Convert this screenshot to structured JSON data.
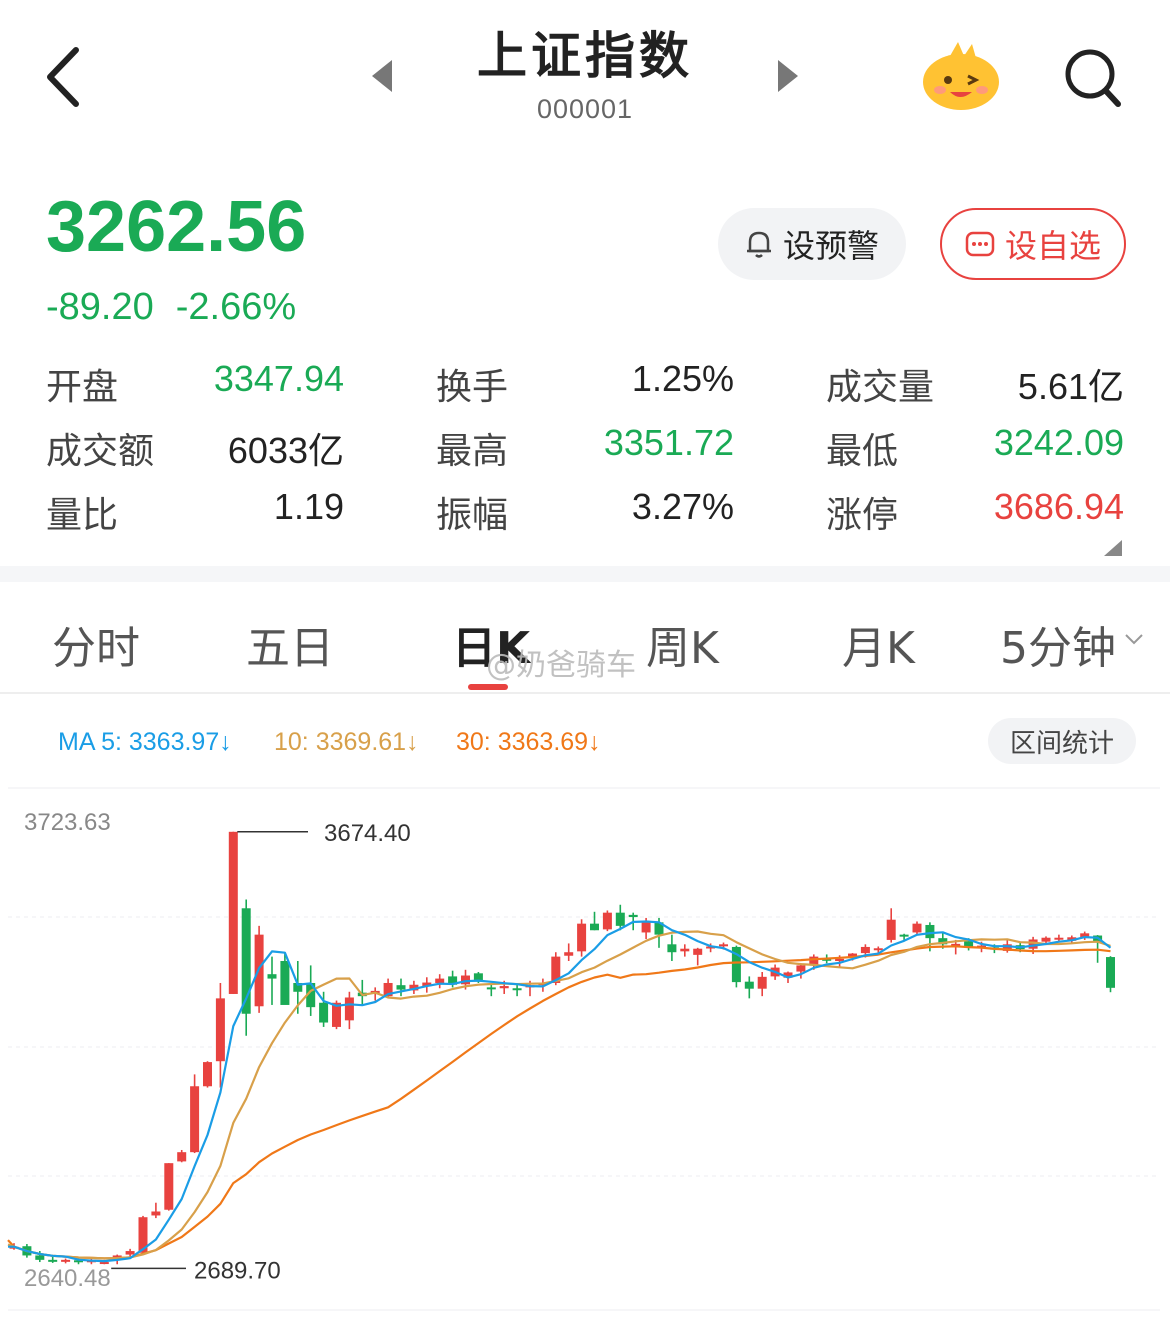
{
  "header": {
    "title": "上证指数",
    "code": "000001"
  },
  "quote": {
    "price": "3262.56",
    "change": "-89.20",
    "change_pct": "-2.66%",
    "color_down": "#1aaa55",
    "color_up": "#e8423f"
  },
  "buttons": {
    "alert": "设预警",
    "favorite": "设自选"
  },
  "stats": [
    {
      "label": "开盘",
      "value": "3347.94",
      "tone": "green"
    },
    {
      "label": "换手",
      "value": "1.25%",
      "tone": "dark"
    },
    {
      "label": "成交量",
      "value": "5.61亿",
      "tone": "dark"
    },
    {
      "label": "成交额",
      "value": "6033亿",
      "tone": "dark"
    },
    {
      "label": "最高",
      "value": "3351.72",
      "tone": "green"
    },
    {
      "label": "最低",
      "value": "3242.09",
      "tone": "green"
    },
    {
      "label": "量比",
      "value": "1.19",
      "tone": "dark"
    },
    {
      "label": "振幅",
      "value": "3.27%",
      "tone": "dark"
    },
    {
      "label": "涨停",
      "value": "3686.94",
      "tone": "red"
    }
  ],
  "tabs": [
    {
      "label": "分时"
    },
    {
      "label": "五日"
    },
    {
      "label": "日K"
    },
    {
      "label": "周K"
    },
    {
      "label": "月K"
    },
    {
      "label": "5分钟"
    }
  ],
  "active_tab": "日K",
  "watermark": "@奶爸骑车",
  "ma": {
    "ma5": "MA 5: 3363.97",
    "ma10": "10: 3369.61",
    "ma30": "30: 3363.69",
    "arrow": "↓",
    "colors": {
      "ma5": "#1a9de6",
      "ma10": "#d8a04a",
      "ma30": "#f07818"
    }
  },
  "range_stats": "区间统计",
  "chart_data": {
    "type": "candlestick",
    "y_axis_labels": {
      "top": "3723.63",
      "bottom": "2640.48"
    },
    "ylim": [
      2640.48,
      3723.63
    ],
    "annotations": {
      "high": "3674.40",
      "low": "2689.70"
    },
    "candles": [
      [
        2728,
        2738,
        2723,
        2730
      ],
      [
        2731,
        2736,
        2705,
        2710
      ],
      [
        2710,
        2720,
        2695,
        2700
      ],
      [
        2700,
        2707,
        2693,
        2697
      ],
      [
        2697,
        2703,
        2692,
        2700
      ],
      [
        2699,
        2705,
        2690,
        2695
      ],
      [
        2696,
        2702,
        2690,
        2699
      ],
      [
        2695,
        2700,
        2690,
        2695
      ],
      [
        2700,
        2712,
        2690,
        2710
      ],
      [
        2712,
        2725,
        2705,
        2720
      ],
      [
        2716,
        2800,
        2714,
        2797
      ],
      [
        2801,
        2830,
        2795,
        2810
      ],
      [
        2814,
        2920,
        2812,
        2920
      ],
      [
        2924,
        2950,
        2922,
        2945
      ],
      [
        2945,
        3122,
        2943,
        3095
      ],
      [
        3095,
        3152,
        3092,
        3150
      ],
      [
        3152,
        3330,
        3092,
        3295
      ],
      [
        3305,
        3674,
        3305,
        3674
      ],
      [
        3500,
        3520,
        3210,
        3260
      ],
      [
        3277,
        3460,
        3262,
        3440
      ],
      [
        3350,
        3390,
        3280,
        3340
      ],
      [
        3380,
        3400,
        3380,
        3280
      ],
      [
        3330,
        3380,
        3260,
        3310
      ],
      [
        3330,
        3370,
        3255,
        3275
      ],
      [
        3285,
        3310,
        3230,
        3240
      ],
      [
        3230,
        3290,
        3225,
        3285
      ],
      [
        3245,
        3310,
        3225,
        3297
      ],
      [
        3308,
        3337,
        3280,
        3300
      ],
      [
        3305,
        3320,
        3290,
        3312
      ],
      [
        3300,
        3340,
        3295,
        3330
      ],
      [
        3325,
        3340,
        3300,
        3315
      ],
      [
        3313,
        3335,
        3305,
        3326
      ],
      [
        3322,
        3343,
        3308,
        3331
      ],
      [
        3330,
        3350,
        3318,
        3340
      ],
      [
        3345,
        3358,
        3320,
        3326
      ],
      [
        3327,
        3360,
        3315,
        3347
      ],
      [
        3352,
        3355,
        3330,
        3333
      ],
      [
        3320,
        3330,
        3300,
        3318
      ],
      [
        3318,
        3335,
        3305,
        3323
      ],
      [
        3318,
        3330,
        3300,
        3315
      ],
      [
        3320,
        3335,
        3300,
        3325
      ],
      [
        3325,
        3340,
        3310,
        3330
      ],
      [
        3330,
        3400,
        3325,
        3390
      ],
      [
        3392,
        3420,
        3380,
        3400
      ],
      [
        3402,
        3475,
        3390,
        3465
      ],
      [
        3465,
        3492,
        3450,
        3450
      ],
      [
        3452,
        3495,
        3448,
        3490
      ],
      [
        3490,
        3508,
        3450,
        3460
      ],
      [
        3485,
        3490,
        3450,
        3480
      ],
      [
        3445,
        3478,
        3430,
        3470
      ],
      [
        3468,
        3478,
        3410,
        3440
      ],
      [
        3418,
        3440,
        3380,
        3400
      ],
      [
        3402,
        3418,
        3390,
        3408
      ],
      [
        3394,
        3410,
        3370,
        3408
      ],
      [
        3410,
        3420,
        3400,
        3413
      ],
      [
        3415,
        3422,
        3406,
        3418
      ],
      [
        3412,
        3415,
        3320,
        3332
      ],
      [
        3333,
        3345,
        3295,
        3317
      ],
      [
        3317,
        3355,
        3300,
        3344
      ],
      [
        3345,
        3372,
        3337,
        3365
      ],
      [
        3342,
        3356,
        3330,
        3354
      ],
      [
        3356,
        3375,
        3340,
        3370
      ],
      [
        3370,
        3395,
        3360,
        3390
      ],
      [
        3385,
        3395,
        3375,
        3381
      ],
      [
        3380,
        3393,
        3366,
        3385
      ],
      [
        3390,
        3398,
        3381,
        3397
      ],
      [
        3398,
        3418,
        3388,
        3412
      ],
      [
        3407,
        3413,
        3396,
        3409
      ],
      [
        3428,
        3500,
        3422,
        3474
      ],
      [
        3440,
        3442,
        3428,
        3438
      ],
      [
        3445,
        3470,
        3440,
        3465
      ],
      [
        3462,
        3468,
        3402,
        3432
      ],
      [
        3432,
        3446,
        3408,
        3418
      ],
      [
        3418,
        3428,
        3395,
        3419
      ],
      [
        3425,
        3432,
        3404,
        3410
      ],
      [
        3410,
        3424,
        3400,
        3415
      ],
      [
        3411,
        3418,
        3398,
        3406
      ],
      [
        3403,
        3427,
        3399,
        3418
      ],
      [
        3416,
        3423,
        3400,
        3407
      ],
      [
        3408,
        3435,
        3396,
        3429
      ],
      [
        3424,
        3436,
        3419,
        3433
      ],
      [
        3430,
        3440,
        3422,
        3433
      ],
      [
        3426,
        3438,
        3420,
        3434
      ],
      [
        3433,
        3447,
        3428,
        3443
      ],
      [
        3438,
        3439,
        3376,
        3422
      ],
      [
        3389,
        3391,
        3309,
        3319
      ]
    ]
  }
}
